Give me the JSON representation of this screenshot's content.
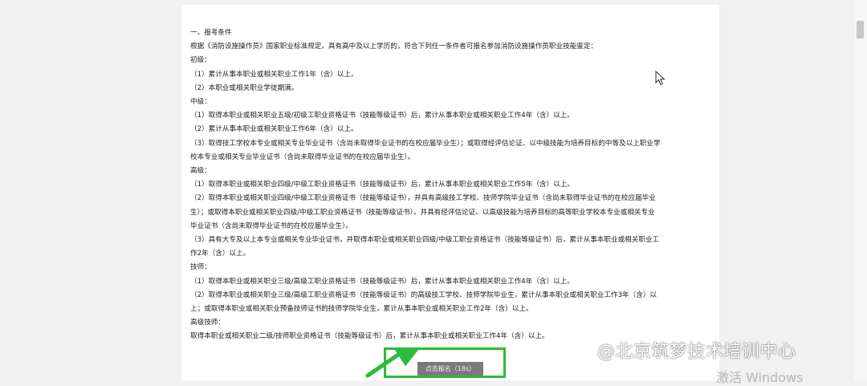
{
  "document": {
    "lines": [
      "一、报考条件",
      "根据《消防设施操作员》国家职业标准规定，具有高中及以上学历的，符合下列任一条件者可报名参加消防设施操作员职业技能鉴定：",
      "初级：",
      "（1）累计从事本职业或相关职业工作1年（含）以上。",
      "（2）本职业或相关职业学徒期满。",
      "中级：",
      "（1）取得本职业或相关职业五级/初级工职业资格证书（技能等级证书）后，累计从事本职业或相关职业工作4年（含）以上。",
      "（2）累计从事本职业或相关职业工作6年（含）以上。",
      "（3）取得技工学校本专业或相关专业毕业证书（含尚未取得毕业证书的在校应届毕业生）；或取得经评估论证、以中级技能为培养目标的中等及以上职业学",
      "校本专业或相关专业毕业证书（含尚未取得毕业证书的在校应届毕业生）。",
      "高级：",
      "（1）取得本职业或相关职业四级/中级工职业资格证书（技能等级证书）后，累计从事本职业或相关职业工作5年（含）以上。",
      "（2）取得本职业或相关职业四级/中级工职业资格证书（技能等级证书），并具有高级技工学校、技师学院毕业证书（含尚未取得毕业证书的在校应届毕业",
      "生）；或取得本职业或相关职业四级/中级工职业资格证书（技能等级证书），并具有经评估论证、以高级技能为培养目标的高等职业学校本专业或相关专业",
      "毕业证书（含尚未取得毕业证书的在校应届毕业生）。",
      "（3）具有大专及以上本专业或相关专业毕业证书，并取得本职业或相关职业四级/中级工职业资格证书（技能等级证书）后，累计从事本职业或相关职业工",
      "作2年（含）以上。",
      "技师：",
      "（1）取得本职业或相关职业三级/高级工职业资格证书（技能等级证书）后，累计从事本职业或相关职业工作4年（含）以上。",
      "（2）取得本职业或相关职业三级/高级工职业资格证书（技能等级证书）的高级技工学校、技师学院毕业生，累计从事本职业或相关职业工作3年（含）以",
      "上；或取得本职业或相关职业预备技师证书的技师学院毕业生，累计从事本职业或相关职业工作2年（含）以上。",
      "高级技师：",
      "取得本职业或相关职业二级/技师职业资格证书（技能等级证书）后，累计从事本职业或相关职业工作4年（含）以上。"
    ]
  },
  "button": {
    "label": "点击报名（18s）"
  },
  "watermark": {
    "text": "@北京筑梦技术培训中心"
  },
  "os_overlay": {
    "activate_text": "激活 Windows"
  },
  "icons": {
    "cursor": "mouse-pointer-icon",
    "arrow": "green-arrow-annotation",
    "logo": "toutiao-logo-icon"
  },
  "colors": {
    "highlight": "#2dbb3c",
    "button_bg": "#7a7a7a"
  }
}
